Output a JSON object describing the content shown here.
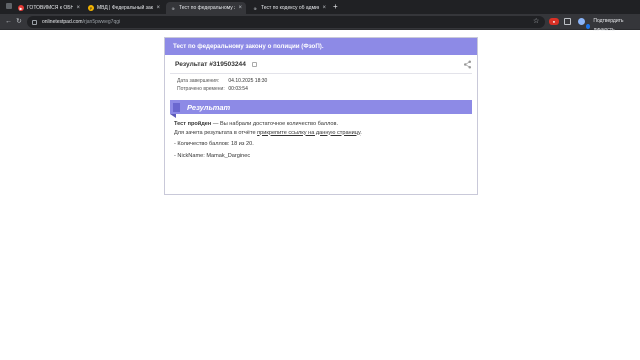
{
  "browser": {
    "tabs": [
      {
        "label": "ГОТОВИМСЯ к ОБНОВЕ! КАК",
        "favicon_color": "#e53935",
        "favicon_glyph": "▶",
        "active": false
      },
      {
        "label": "МВД | Федеральный закон о",
        "favicon_color": "#f4b400",
        "favicon_glyph": "P",
        "active": false
      },
      {
        "label": "Тест по федеральному закон",
        "favicon_color": "#9aa0a6",
        "favicon_glyph": "⊕",
        "active": true
      },
      {
        "label": "Тест по кодексу об админист",
        "favicon_color": "#9aa0a6",
        "favicon_glyph": "⊕",
        "active": false
      }
    ],
    "new_tab_glyph": "+",
    "url_domain": "onlinetestpad.com",
    "url_path": "/rjan5pwweg7qgi",
    "verify_label": "Подтвердить личность"
  },
  "card": {
    "header": "Тест по федеральному закону о полиции (ФзоП).",
    "result_title": "Результат #319503244",
    "meta": [
      {
        "label": "Дата завершения:",
        "value": "04.10.2025 18:30"
      },
      {
        "label": "Потрачено времени:",
        "value": "00:03:54"
      }
    ],
    "banner": "Результат",
    "line1_bold": "Тест пройден",
    "line1_rest": " — Вы набрали достаточное количество баллов.",
    "line2_pre": "Для зачета результата в отчёте ",
    "line2_link": "прикрепите ссылку на данную страницу",
    "line2_post": ".",
    "score_line": "- Количество баллов: 18 из 20.",
    "nick_line": "- NickName: Mamak_Darginec"
  },
  "colors": {
    "accent": "#8d8ae6",
    "chrome_dark": "#202124",
    "chrome_toolbar": "#35363a"
  }
}
